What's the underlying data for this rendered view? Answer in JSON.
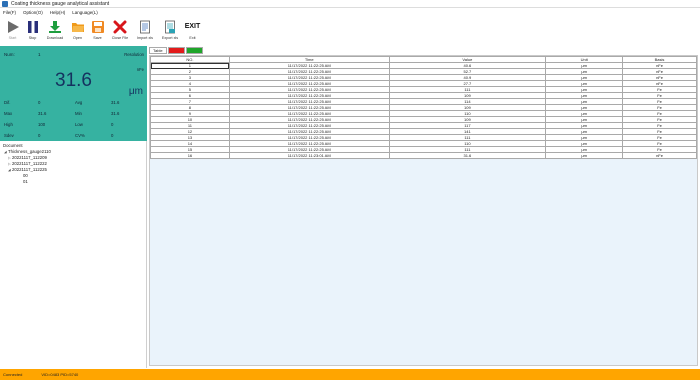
{
  "window": {
    "title": "Coating thickness gauge analytical assistant"
  },
  "menu": [
    {
      "label": "File(F)"
    },
    {
      "label": "Option(O)"
    },
    {
      "label": "Help(H)"
    },
    {
      "label": "Language(L)"
    }
  ],
  "toolbar": {
    "start": "Start",
    "stop": "Stop",
    "download": "Download",
    "open": "Open",
    "save": "Save",
    "close_file": "Close File",
    "import_xls": "Import xls",
    "export_xls": "Export xls",
    "exit": "Exit",
    "exit_glyph": "EXIT"
  },
  "file_path": "Unsaved file Thicknessgauge2110/20221117_112205.ctg",
  "measurement": {
    "num_label": "Num:",
    "num_value": "1",
    "resolution_label": "Resolution",
    "basis": "nFe",
    "value": "31.6",
    "unit": "μm",
    "stats": {
      "dif_label": "Dif.",
      "dif_value": "0",
      "avg_label": "Avg",
      "avg_value": "31.6",
      "max_label": "Max",
      "max_value": "31.6",
      "min_label": "Min",
      "min_value": "31.6",
      "high_label": "High",
      "high_value": "100",
      "low_label": "Low",
      "low_value": "0",
      "sdev_label": "Sdev",
      "sdev_value": "0",
      "cv_label": "CV%",
      "cv_value": "0"
    }
  },
  "tree": {
    "header": "Document",
    "root": "Thickness_gauge2110",
    "items": [
      "20221117_112209",
      "20221117_112222",
      "20221117_112225"
    ],
    "children": [
      "00",
      "01"
    ]
  },
  "tabs": {
    "table": "Table",
    "tab_red": "Lines",
    "tab_green": "Stats"
  },
  "table": {
    "columns": [
      "NO.",
      "Time",
      "Value",
      "Unit",
      "Basis"
    ],
    "rows": [
      [
        "1",
        "11/17/2022 11:22:25 AM",
        "40.6",
        "μm",
        "nFe"
      ],
      [
        "2",
        "11/17/2022 11:22:25 AM",
        "52.7",
        "μm",
        "nFe"
      ],
      [
        "3",
        "11/17/2022 11:22:25 AM",
        "40.9",
        "μm",
        "nFe"
      ],
      [
        "4",
        "11/17/2022 11:22:25 AM",
        "27.7",
        "μm",
        "nFe"
      ],
      [
        "5",
        "11/17/2022 11:22:25 AM",
        "111",
        "μm",
        "Fe"
      ],
      [
        "6",
        "11/17/2022 11:22:25 AM",
        "109",
        "μm",
        "Fe"
      ],
      [
        "7",
        "11/17/2022 11:22:25 AM",
        "114",
        "μm",
        "Fe"
      ],
      [
        "8",
        "11/17/2022 11:22:25 AM",
        "109",
        "μm",
        "Fe"
      ],
      [
        "9",
        "11/17/2022 11:22:25 AM",
        "110",
        "μm",
        "Fe"
      ],
      [
        "10",
        "11/17/2022 11:22:25 AM",
        "109",
        "μm",
        "Fe"
      ],
      [
        "11",
        "11/17/2022 11:22:25 AM",
        "117",
        "μm",
        "Fe"
      ],
      [
        "12",
        "11/17/2022 11:22:25 AM",
        "141",
        "μm",
        "Fe"
      ],
      [
        "13",
        "11/17/2022 11:22:25 AM",
        "111",
        "μm",
        "Fe"
      ],
      [
        "14",
        "11/17/2022 11:22:25 AM",
        "110",
        "μm",
        "Fe"
      ],
      [
        "15",
        "11/17/2022 11:22:25 AM",
        "111",
        "μm",
        "Fe"
      ],
      [
        "16",
        "11/17/2022 11:23:01 AM",
        "31.6",
        "μm",
        "nFe"
      ]
    ]
  },
  "status": {
    "connection": "Connected",
    "device": "VID=0483 PID=5740"
  },
  "colors": {
    "measure_panel": "#36b2a1",
    "status_bar": "#ffa500",
    "tab_red": "#e21b1b",
    "tab_green": "#1fa52a"
  }
}
